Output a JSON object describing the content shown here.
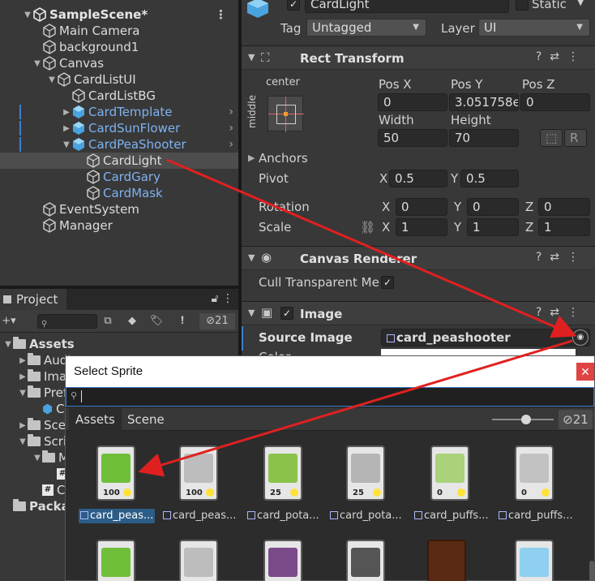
{
  "hierarchy": {
    "scene": "SampleScene*",
    "items": [
      {
        "label": "Main Camera",
        "type": "object"
      },
      {
        "label": "background1",
        "type": "object"
      },
      {
        "label": "Canvas",
        "type": "object"
      },
      {
        "label": "CardListUI",
        "type": "object"
      },
      {
        "label": "CardListBG",
        "type": "object"
      },
      {
        "label": "CardTemplate",
        "type": "prefab"
      },
      {
        "label": "CardSunFlower",
        "type": "prefab"
      },
      {
        "label": "CardPeaShooter",
        "type": "prefab"
      },
      {
        "label": "CardLight",
        "type": "object"
      },
      {
        "label": "CardGary",
        "type": "prefab-child"
      },
      {
        "label": "CardMask",
        "type": "prefab-child"
      },
      {
        "label": "EventSystem",
        "type": "object"
      },
      {
        "label": "Manager",
        "type": "object"
      }
    ]
  },
  "project": {
    "tab": "Project",
    "hidden_count": "21",
    "tree": [
      {
        "label": "Assets"
      },
      {
        "label": "Audio"
      },
      {
        "label": "Images"
      },
      {
        "label": "Prefabs"
      },
      {
        "label": "Ca"
      },
      {
        "label": "Scenes"
      },
      {
        "label": "Scripts"
      },
      {
        "label": "Ma"
      },
      {
        "label": ""
      },
      {
        "label": "Ca"
      },
      {
        "label": "Packages"
      }
    ]
  },
  "inspector": {
    "object_name": "CardLight",
    "static_label": "Static",
    "tag_label": "Tag",
    "tag_value": "Untagged",
    "layer_label": "Layer",
    "layer_value": "UI",
    "rect_transform": {
      "title": "Rect Transform",
      "anchor_h": "center",
      "anchor_v": "middle",
      "pos_x_label": "Pos X",
      "pos_y_label": "Pos Y",
      "pos_z_label": "Pos Z",
      "pos_x": "0",
      "pos_y": "3.051758e",
      "pos_z": "0",
      "width_label": "Width",
      "height_label": "Height",
      "width": "50",
      "height": "70",
      "anchors_label": "Anchors",
      "pivot_label": "Pivot",
      "pivot_x": "0.5",
      "pivot_y": "0.5",
      "rotation_label": "Rotation",
      "rot_x": "0",
      "rot_y": "0",
      "rot_z": "0",
      "scale_label": "Scale",
      "scale_x": "1",
      "scale_y": "1",
      "scale_z": "1",
      "x": "X",
      "y": "Y",
      "z": "Z",
      "r_button": "R"
    },
    "canvas_renderer": {
      "title": "Canvas Renderer",
      "cull_label": "Cull Transparent Me"
    },
    "image": {
      "title": "Image",
      "source_label": "Source Image",
      "source_value": "card_peashooter",
      "color_label": "Color"
    }
  },
  "sprite_window": {
    "title": "Select Sprite",
    "tab_assets": "Assets",
    "tab_scene": "Scene",
    "hidden_count": "21",
    "slider_value": 0.55,
    "items": [
      {
        "label": "card_peas...",
        "cost": "100",
        "selected": true,
        "art": "#6fbf3a"
      },
      {
        "label": "card_peas...",
        "cost": "100",
        "selected": false,
        "art": "#bdbdbd"
      },
      {
        "label": "card_pota...",
        "cost": "25",
        "selected": false,
        "art": "#8bc34a"
      },
      {
        "label": "card_pota...",
        "cost": "25",
        "selected": false,
        "art": "#b5b5b5"
      },
      {
        "label": "card_puffs...",
        "cost": "0",
        "selected": false,
        "art": "#a9d27a"
      },
      {
        "label": "card_puffs...",
        "cost": "0",
        "selected": false,
        "art": "#c2c2c2"
      }
    ]
  },
  "colors": {
    "prefab_text": "#7fb2f0",
    "selection": "#2c5d87",
    "arrow": "#e02020"
  }
}
